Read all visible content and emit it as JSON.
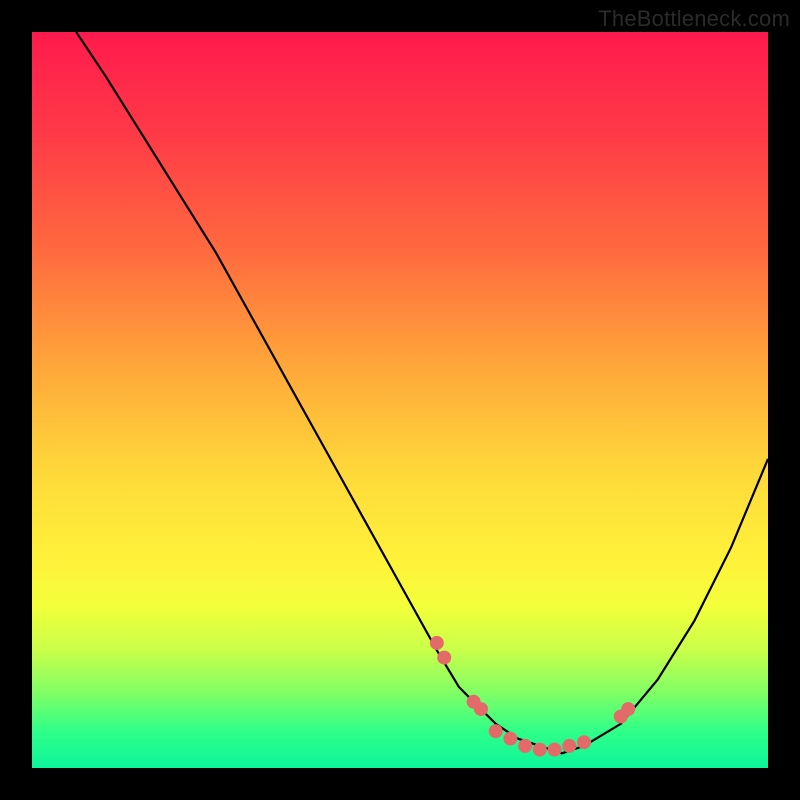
{
  "watermark": "TheBottleneck.com",
  "chart_data": {
    "type": "line",
    "title": "",
    "xlabel": "",
    "ylabel": "",
    "xlim": [
      0,
      100
    ],
    "ylim": [
      0,
      100
    ],
    "curve": {
      "name": "bottleneck-curve",
      "x": [
        6,
        10,
        15,
        20,
        25,
        30,
        35,
        40,
        45,
        50,
        55,
        58,
        60,
        63,
        66,
        69,
        72,
        75,
        80,
        85,
        90,
        95,
        100
      ],
      "y": [
        100,
        94,
        86,
        78,
        70,
        61,
        52,
        43,
        34,
        25,
        16,
        11,
        9,
        6,
        4,
        3,
        2,
        3,
        6,
        12,
        20,
        30,
        42
      ]
    },
    "markers": {
      "name": "highlight-points",
      "color": "#e46a6a",
      "x": [
        55,
        56,
        60,
        61,
        63,
        65,
        67,
        69,
        71,
        73,
        75,
        80,
        81
      ],
      "y": [
        17,
        15,
        9,
        8,
        5,
        4,
        3,
        2.5,
        2.5,
        3,
        3.5,
        7,
        8
      ]
    },
    "gradient_stops": [
      {
        "pos": 0,
        "color": "#ff1a4d"
      },
      {
        "pos": 50,
        "color": "#ffd93a"
      },
      {
        "pos": 100,
        "color": "#0cf59a"
      }
    ]
  }
}
